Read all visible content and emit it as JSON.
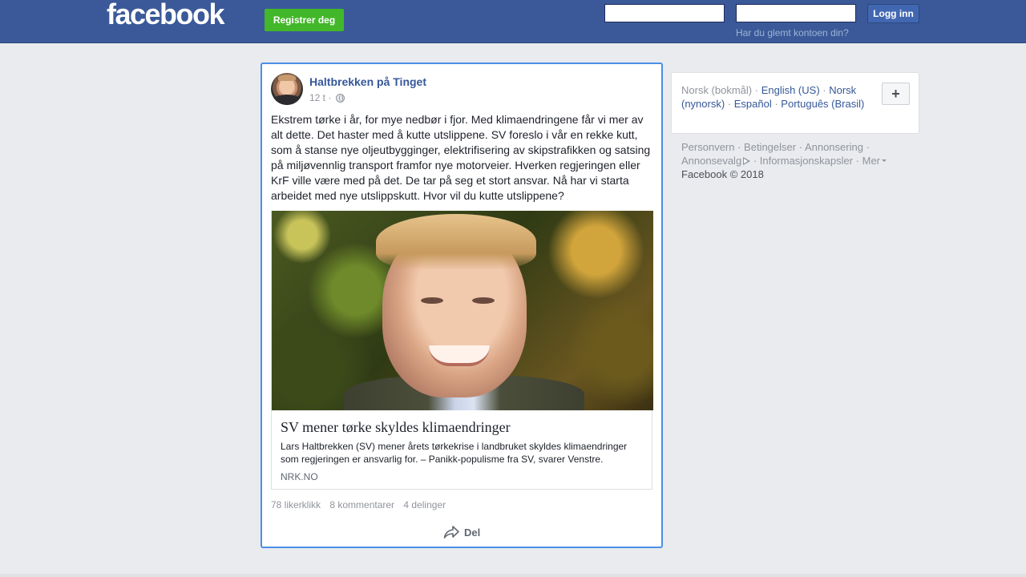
{
  "header": {
    "logo": "facebook",
    "register_label": "Registrer deg",
    "login_label": "Logg inn",
    "forgot_label": "Har du glemt kontoen din?",
    "email_value": "",
    "password_value": ""
  },
  "post": {
    "author": "Haltbrekken på Tinget",
    "time": "12 t ·",
    "text": "Ekstrem tørke i år, for mye nedbør i fjor. Med klimaendringene får vi mer av alt dette. Det haster med å kutte utslippene. SV foreslo i vår en rekke kutt, som å stanse nye oljeutbygginger, elektrifisering av skipstrafikken og satsing på miljøvennlig transport framfor nye motorveier. Hverken regjeringen eller KrF ville være med på det. De tar på seg et stort ansvar. Nå har vi starta arbeidet med nye utslippskutt. Hvor vil du kutte utslippene?",
    "link": {
      "title": "SV mener tørke skyldes klimaendringer",
      "description": "Lars Haltbrekken (SV) mener årets tørkekrise i landbruket skyldes klimaendringer som regjeringen er ansvarlig for. – Panikk-populisme fra SV, svarer Venstre.",
      "domain": "NRK.NO"
    },
    "stats": {
      "likes": "78 likerklikk",
      "comments": "8 kommentarer",
      "shares": "4 delinger"
    },
    "share_label": "Del"
  },
  "languages": {
    "current": "Norsk (bokmål)",
    "items": [
      "English (US)",
      "Norsk (nynorsk)",
      "Español",
      "Português (Brasil)"
    ],
    "add_label": "+"
  },
  "footer": {
    "links": [
      "Personvern",
      "Betingelser",
      "Annonsering",
      "Annonsevalg",
      "Informasjonskapsler",
      "Mer"
    ],
    "copyright": "Facebook © 2018"
  },
  "colors": {
    "brand": "#3b5998",
    "register": "#42b72a",
    "link": "#365899",
    "focus_border": "#4c8fe5"
  }
}
